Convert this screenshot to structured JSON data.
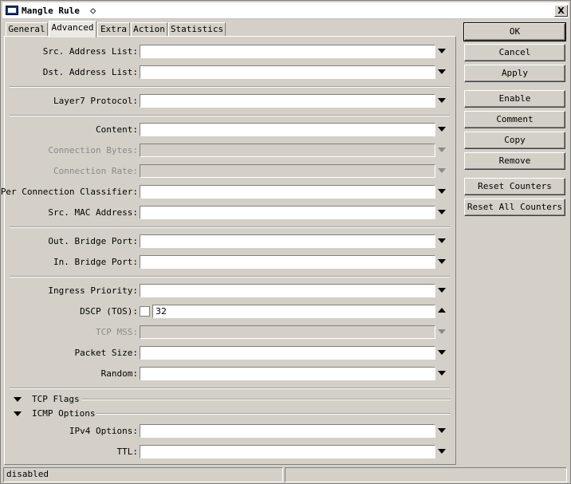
{
  "window": {
    "title": "Mangle Rule",
    "title_suffix_icon": "diamond-icon",
    "close_label": "X"
  },
  "tabs": [
    {
      "label": "General",
      "active": false
    },
    {
      "label": "Advanced",
      "active": true
    },
    {
      "label": "Extra",
      "active": false
    },
    {
      "label": "Action",
      "active": false
    },
    {
      "label": "Statistics",
      "active": false
    }
  ],
  "fields": {
    "src_address_list": {
      "label": "Src. Address List:",
      "value": ""
    },
    "dst_address_list": {
      "label": "Dst. Address List:",
      "value": ""
    },
    "layer7_protocol": {
      "label": "Layer7 Protocol:",
      "value": ""
    },
    "content": {
      "label": "Content:",
      "value": ""
    },
    "connection_bytes": {
      "label": "Connection Bytes:",
      "value": ""
    },
    "connection_rate": {
      "label": "Connection Rate:",
      "value": ""
    },
    "per_connection_classifier": {
      "label": "Per Connection Classifier:",
      "value": ""
    },
    "src_mac_address": {
      "label": "Src. MAC Address:",
      "value": ""
    },
    "out_bridge_port": {
      "label": "Out. Bridge Port:",
      "value": ""
    },
    "in_bridge_port": {
      "label": "In. Bridge Port:",
      "value": ""
    },
    "ingress_priority": {
      "label": "Ingress Priority:",
      "value": ""
    },
    "dscp_tos": {
      "label": "DSCP (TOS):",
      "value": "32"
    },
    "tcp_mss": {
      "label": "TCP MSS:",
      "value": ""
    },
    "packet_size": {
      "label": "Packet Size:",
      "value": ""
    },
    "random": {
      "label": "Random:",
      "value": ""
    },
    "ipv4_options": {
      "label": "IPv4 Options:",
      "value": ""
    },
    "ttl": {
      "label": "TTL:",
      "value": ""
    }
  },
  "sections": {
    "tcp_flags": "TCP Flags",
    "icmp_options": "ICMP Options"
  },
  "buttons": {
    "ok": "OK",
    "cancel": "Cancel",
    "apply": "Apply",
    "enable": "Enable",
    "comment": "Comment",
    "copy": "Copy",
    "remove": "Remove",
    "reset_counters": "Reset Counters",
    "reset_all_counters": "Reset All Counters"
  },
  "status": {
    "left": "disabled",
    "right": ""
  }
}
